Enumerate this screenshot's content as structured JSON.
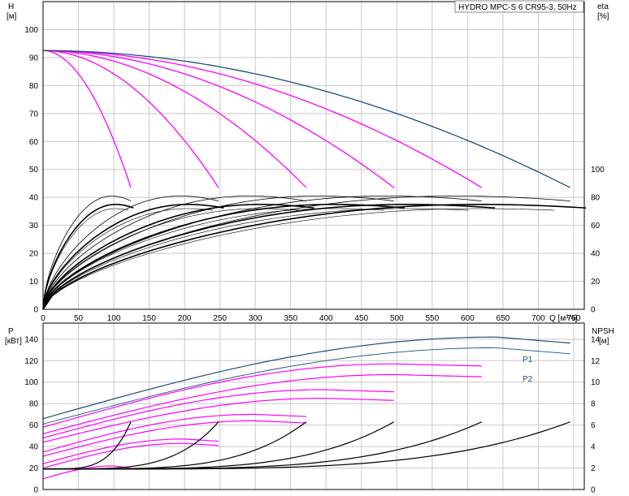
{
  "chart_data": [
    {
      "type": "line",
      "title": "HYDRO MPC-S 6 CR95-3, 50Hz",
      "xlabel": "Q [м³/ч]",
      "ylabel_left": [
        "H",
        "[м]"
      ],
      "ylabel_right": [
        "eta",
        "[%]"
      ],
      "xlim": [
        0,
        765
      ],
      "ylim_left": [
        0,
        110
      ],
      "ylim_right": [
        0,
        100
      ],
      "x_ticks": [
        "0",
        "50",
        "100",
        "150",
        "200",
        "250",
        "300",
        "350",
        "400",
        "450",
        "500",
        "550",
        "600",
        "650",
        "700",
        "750"
      ],
      "y_left_ticks": [
        "0",
        "10",
        "20",
        "30",
        "40",
        "50",
        "60",
        "70",
        "80",
        "90",
        "100"
      ],
      "y_right_ticks": [
        "0",
        "20",
        "40",
        "60",
        "80",
        "100"
      ],
      "grid": true,
      "shutoff_head": 92.5,
      "end_head": 43.5,
      "qmax": [
        124,
        248,
        372,
        496,
        620,
        745
      ],
      "colors": {
        "full_speed": "#1f4e79",
        "reduced": "#ff00ff",
        "eta": "#000000"
      }
    },
    {
      "type": "line",
      "ylabel_left": [
        "P",
        "[кВт]"
      ],
      "ylabel_right": [
        "NPSH",
        "[м]"
      ],
      "xlim": [
        0,
        765
      ],
      "ylim_left": [
        0,
        155
      ],
      "ylim_right": [
        0,
        15.5
      ],
      "y_left_ticks": [
        "0",
        "20",
        "40",
        "60",
        "80",
        "100",
        "120",
        "140"
      ],
      "y_right_ticks": [
        "0",
        "2",
        "4",
        "6",
        "8",
        "10",
        "12",
        "14"
      ],
      "grid": true,
      "series": [
        {
          "name": "P1",
          "color": "#1f4e79"
        },
        {
          "name": "P2",
          "color": "#1f4e79"
        }
      ],
      "p1_peak": 142,
      "p2_peak": 132,
      "npsh_end": 6.3
    }
  ]
}
